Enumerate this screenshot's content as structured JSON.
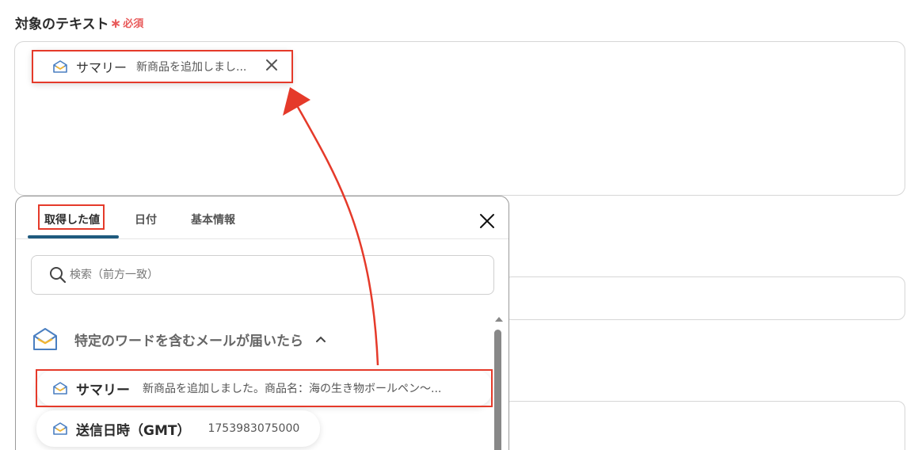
{
  "field": {
    "label": "対象のテキスト",
    "required_label": "必須"
  },
  "chip": {
    "icon": "mail-open-icon",
    "name": "サマリー",
    "preview": "新商品を追加しまし..."
  },
  "panel": {
    "tabs": [
      {
        "label": "取得した値"
      },
      {
        "label": "日付"
      },
      {
        "label": "基本情報"
      }
    ],
    "search": {
      "placeholder": "検索（前方一致）"
    },
    "section": {
      "title": "特定のワードを含むメールが届いたら"
    },
    "items": [
      {
        "name": "サマリー",
        "value": "新商品を追加しました。商品名：海の生き物ボールペン〜..."
      },
      {
        "name": "送信日時（GMT）",
        "value": "1753983075000"
      }
    ]
  },
  "colors": {
    "highlight": "#e53a2a",
    "tab_underline": "#1f5a7e",
    "required": "#e85a5a",
    "mail_icon_blue": "#4a7fc1",
    "mail_icon_yellow": "#f2b632"
  }
}
